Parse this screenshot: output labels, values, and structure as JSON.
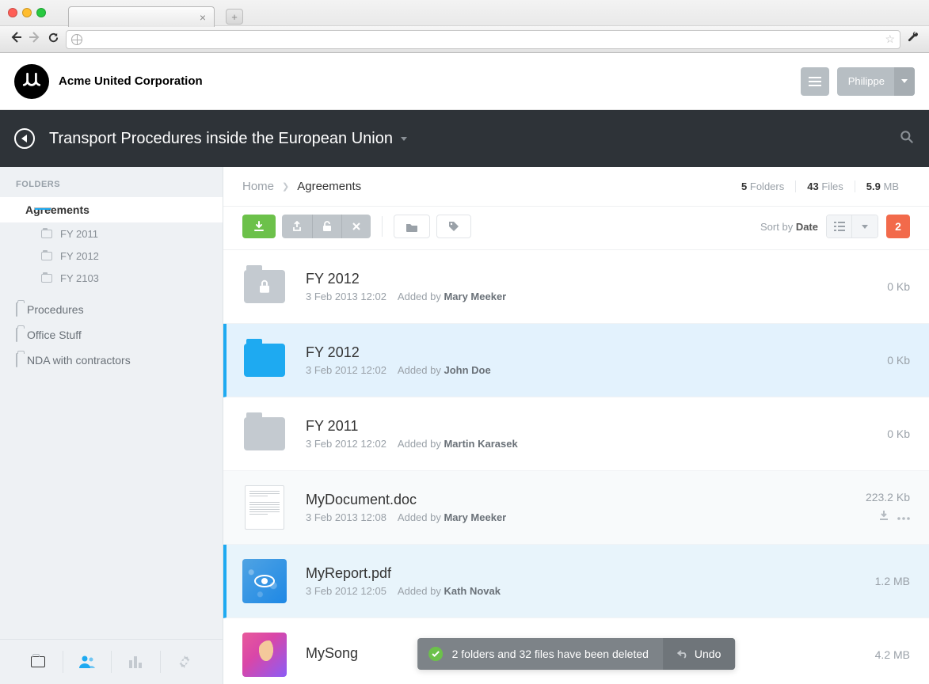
{
  "header": {
    "company_name": "Acme United Corporation",
    "user_name": "Philippe"
  },
  "title_bar": {
    "title": "Transport Procedures inside the European Union"
  },
  "sidebar": {
    "header": "FOLDERS",
    "items": [
      {
        "label": "Agreements",
        "active": true,
        "children": [
          "FY 2011",
          "FY 2012",
          "FY 2103"
        ]
      },
      {
        "label": "Procedures"
      },
      {
        "label": "Office Stuff"
      },
      {
        "label": "NDA with contractors"
      }
    ]
  },
  "breadcrumb": {
    "home": "Home",
    "current": "Agreements"
  },
  "stats": {
    "folders_n": "5",
    "folders_l": "Folders",
    "files_n": "43",
    "files_l": "Files",
    "size_n": "5.9",
    "size_l": "MB"
  },
  "actions": {
    "sort_prefix": "Sort by ",
    "sort_value": "Date",
    "selection_count": "2"
  },
  "files": [
    {
      "name": "FY 2012",
      "date": "3 Feb 2013 12:02",
      "added_by_prefix": "Added by ",
      "added_by": "Mary Meeker",
      "size_n": "0",
      "size_u": "Kb"
    },
    {
      "name": "FY 2012",
      "date": "3 Feb 2012 12:02",
      "added_by_prefix": "Added by ",
      "added_by": "John Doe",
      "size_n": "0",
      "size_u": "Kb"
    },
    {
      "name": "FY 2011",
      "date": "3 Feb 2012 12:02",
      "added_by_prefix": "Added by ",
      "added_by": "Martin Karasek",
      "size_n": "0",
      "size_u": "Kb"
    },
    {
      "name": "MyDocument.doc",
      "date": "3 Feb 2013 12:08",
      "added_by_prefix": "Added by ",
      "added_by": "Mary Meeker",
      "size_n": "223.2",
      "size_u": "Kb"
    },
    {
      "name": "MyReport.pdf",
      "date": "3 Feb 2012 12:05",
      "added_by_prefix": "Added by ",
      "added_by": "Kath Novak",
      "size_n": "1.2",
      "size_u": "MB"
    },
    {
      "name": "MySong",
      "date": "",
      "added_by_prefix": "",
      "added_by": "",
      "size_n": "4.2",
      "size_u": "MB"
    }
  ],
  "toast": {
    "message": "2 folders and 32 files have been deleted",
    "undo": "Undo"
  }
}
